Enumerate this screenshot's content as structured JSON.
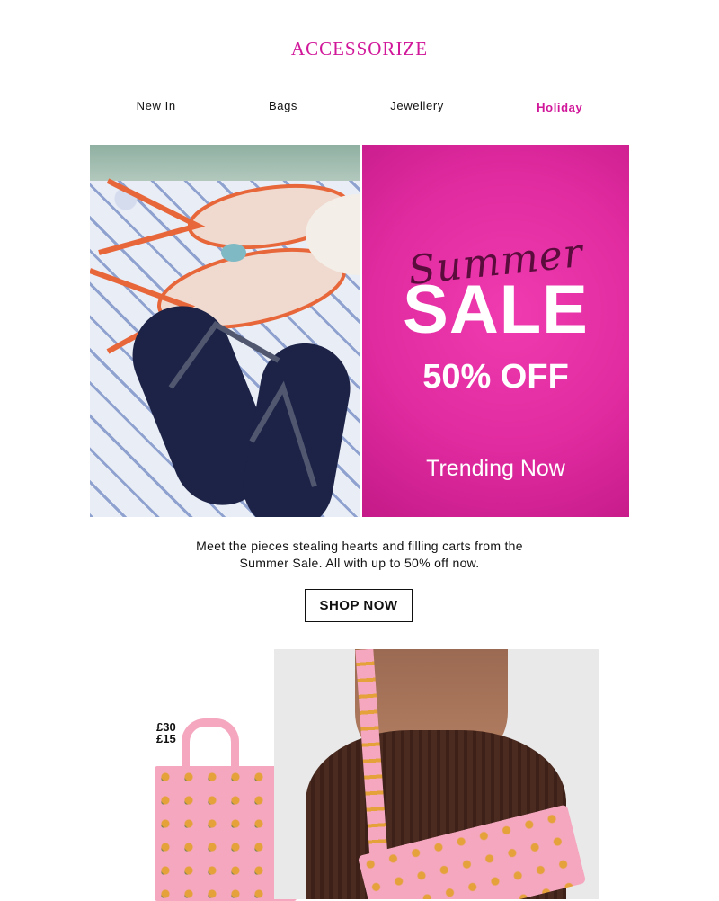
{
  "brand": {
    "logo": "ACCESSORIZE",
    "accent_color": "#d1179a"
  },
  "nav": {
    "items": [
      {
        "label": "New In",
        "active": false
      },
      {
        "label": "Bags",
        "active": false
      },
      {
        "label": "Jewellery",
        "active": false
      },
      {
        "label": "Holiday",
        "active": true
      }
    ]
  },
  "hero": {
    "script_text": "Summer",
    "headline": "SALE",
    "discount": "50% OFF",
    "subline": "Trending Now",
    "background_color": "#e02a9f"
  },
  "intro": {
    "line1": "Meet the pieces stealing hearts and filling carts from the",
    "line2": "Summer Sale. All with up to 50% off now."
  },
  "cta": {
    "label": "SHOP NOW"
  },
  "product": {
    "was_price": "£30",
    "now_price": "£15"
  }
}
